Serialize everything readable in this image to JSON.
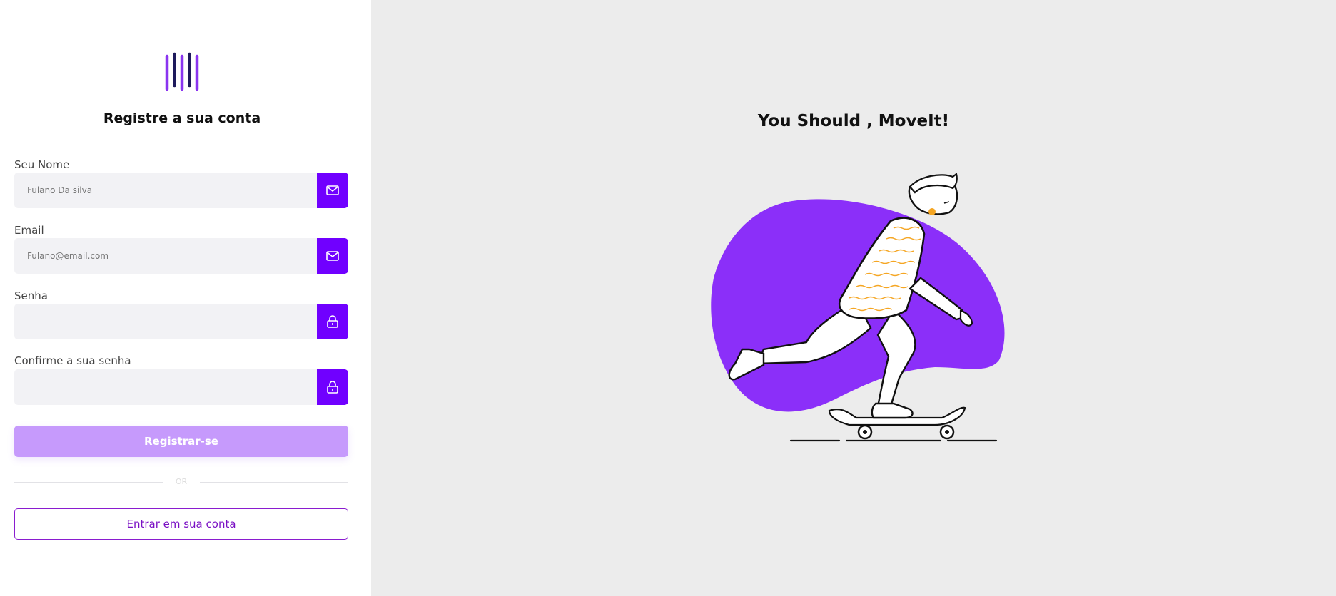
{
  "form": {
    "title": "Registre a sua conta",
    "fields": [
      {
        "label": "Seu Nome",
        "placeholder": "Fulano Da silva",
        "value": "",
        "icon": "mail-icon"
      },
      {
        "label": "Email",
        "placeholder": "Fulano@email.com",
        "value": "",
        "icon": "mail-icon"
      },
      {
        "label": "Senha",
        "placeholder": "",
        "value": "",
        "icon": "lock-icon"
      },
      {
        "label": "Confirme a sua senha",
        "placeholder": "",
        "value": "",
        "icon": "lock-icon"
      }
    ],
    "register_label": "Registrar-se",
    "divider_label": "OR",
    "login_label": "Entrar em sua conta"
  },
  "hero": {
    "title": "You Should , MoveIt!"
  },
  "colors": {
    "accent": "#7000ff",
    "accent_light": "#c69afc",
    "blob": "#8b2ff9",
    "panel_bg": "#ececec"
  }
}
